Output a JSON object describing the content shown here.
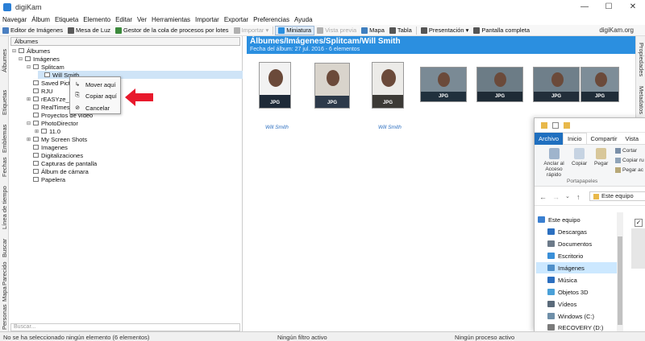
{
  "window": {
    "title": "digiKam",
    "minimize": "—",
    "maximize": "☐",
    "close": "✕"
  },
  "menu": [
    "Navegar",
    "Álbum",
    "Etiqueta",
    "Elemento",
    "Editar",
    "Ver",
    "Herramientas",
    "Importar",
    "Exportar",
    "Preferencias",
    "Ayuda"
  ],
  "toolbar": {
    "items": [
      {
        "label": "Editor de Imágenes",
        "color": "#4a7fc1",
        "disabled": false
      },
      {
        "label": "Mesa de Luz",
        "color": "#5a5a5a",
        "disabled": false
      },
      {
        "label": "Gestor de la cola de procesos por lotes",
        "color": "#3c8a3c",
        "disabled": false
      },
      {
        "label": "Importar",
        "color": "#b0b0b0",
        "disabled": true
      },
      {
        "label": "Miniatura",
        "color": "#2b8fe0",
        "disabled": false
      },
      {
        "label": "Vista previa",
        "color": "#b0b0b0",
        "disabled": true
      },
      {
        "label": "Mapa",
        "color": "#3f7fbf",
        "disabled": false
      },
      {
        "label": "Tabla",
        "color": "#555555",
        "disabled": false
      },
      {
        "label": "Presentación",
        "color": "#555555",
        "disabled": false
      },
      {
        "label": "Pantalla completa",
        "color": "#555555",
        "disabled": false
      }
    ],
    "brand": "digiKam.org"
  },
  "left_sidebar": [
    "Álbumes",
    "Etiquetas",
    "Emblemas",
    "Fechas",
    "Línea de tiempo",
    "Buscar",
    "Parecido",
    "Mapa",
    "Personas"
  ],
  "right_sidebar": [
    "Propiedades",
    "Metadatos"
  ],
  "albums": {
    "header": "Álbumes",
    "tree": [
      {
        "label": "Álbumes",
        "expander": "⊟"
      },
      {
        "label": "Imágenes",
        "expander": "⊟"
      },
      {
        "label": "Splitcam",
        "expander": "⊟"
      },
      {
        "label": "Will Smith",
        "expander": ""
      },
      {
        "label": "Saved Pictu",
        "expander": ""
      },
      {
        "label": "RJU",
        "expander": ""
      },
      {
        "label": "rEASYze_ir",
        "expander": "⊞"
      },
      {
        "label": "RealTimes",
        "expander": ""
      },
      {
        "label": "Proyectos de vídeo",
        "expander": ""
      },
      {
        "label": "PhotoDirector",
        "expander": "⊟"
      },
      {
        "label": "11.0",
        "expander": "⊞"
      },
      {
        "label": "My Screen Shots",
        "expander": "⊞"
      },
      {
        "label": "Imagenes",
        "expander": ""
      },
      {
        "label": "Digitalizaciones",
        "expander": ""
      },
      {
        "label": "Capturas de pantalla",
        "expander": ""
      },
      {
        "label": "Álbum de cámara",
        "expander": ""
      },
      {
        "label": "Papelera",
        "expander": ""
      }
    ],
    "search_placeholder": "Buscar..."
  },
  "context_menu": {
    "items": [
      {
        "label": "Mover aquí",
        "icon": "↳"
      },
      {
        "label": "Copiar aquí",
        "icon": "⎘"
      },
      {
        "label": "Cancelar",
        "icon": "⊘"
      }
    ]
  },
  "album_view": {
    "title": "Álbumes/Imágenes/Splitcam/Will Smith",
    "subtitle": "Fecha del álbum: 27 jul. 2016 - 6 elementos",
    "thumbnails": [
      {
        "tag": "JPG",
        "caption": "Will Smith"
      },
      {
        "tag": "JPG",
        "caption": ""
      },
      {
        "tag": "JPG",
        "caption": "Will Smith"
      },
      {
        "tag": "JPG",
        "caption": ""
      },
      {
        "tag": "JPG",
        "caption": ""
      },
      {
        "tag": "JPG",
        "caption": ""
      },
      {
        "tag": "JPG",
        "caption": ""
      }
    ]
  },
  "explorer": {
    "tabs": [
      "Archivo",
      "Inicio",
      "Compartir",
      "Vista"
    ],
    "ribbon": {
      "pin": "Anclar al Acceso rápido",
      "copy": "Copiar",
      "paste": "Pegar",
      "cut": "Cortar",
      "copy_path": "Copiar ru",
      "paste_shortcut": "Pegar ac",
      "group": "Portapapeles"
    },
    "address": "Este equipo",
    "nav_back": "←",
    "nav_forward": "→",
    "nav_dropdown": "⌄",
    "nav_up": "↑",
    "nav_items": [
      {
        "label": "Este equipo",
        "color": "#3a7fd0"
      },
      {
        "label": "Descargas",
        "color": "#2b6fc0"
      },
      {
        "label": "Documentos",
        "color": "#6c7a89"
      },
      {
        "label": "Escritorio",
        "color": "#3a8fd8"
      },
      {
        "label": "Imágenes",
        "color": "#4f8fc9"
      },
      {
        "label": "Música",
        "color": "#2b6fc0"
      },
      {
        "label": "Objetos 3D",
        "color": "#4aa0d8"
      },
      {
        "label": "Vídeos",
        "color": "#5a6a7a"
      },
      {
        "label": "Windows (C:)",
        "color": "#6f8fa8"
      },
      {
        "label": "RECOVERY (D:)",
        "color": "#7a7a7a"
      }
    ]
  },
  "status": {
    "left": "No se ha seleccionado ningún elemento (6 elementos)",
    "filter": "Ningún filtro activo",
    "process": "Ningún proceso activo"
  }
}
